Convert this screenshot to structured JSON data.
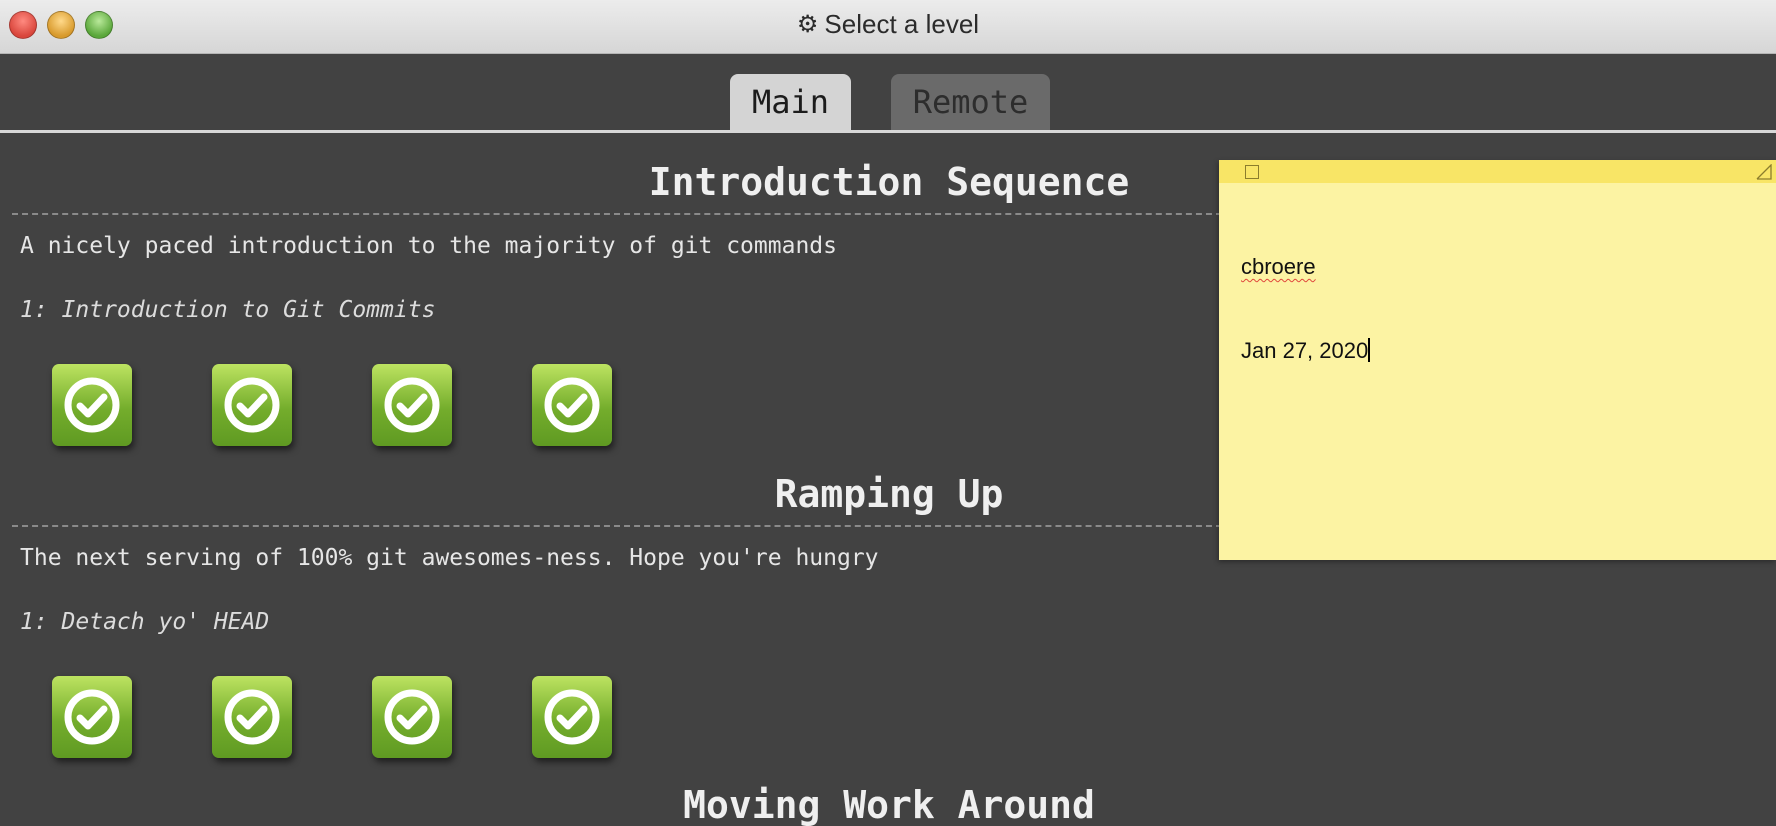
{
  "window": {
    "title": "Select a level",
    "title_icon": "gear-icon"
  },
  "tabs": [
    {
      "label": "Main",
      "active": true
    },
    {
      "label": "Remote",
      "active": false
    }
  ],
  "sections": [
    {
      "title": "Introduction Sequence",
      "description": "A nicely paced introduction to the majority of git commands",
      "level_name": "1: Introduction to Git Commits",
      "levels": [
        {
          "status": "completed",
          "icon": "check-circle-icon"
        },
        {
          "status": "completed",
          "icon": "check-circle-icon"
        },
        {
          "status": "completed",
          "icon": "check-circle-icon"
        },
        {
          "status": "completed",
          "icon": "check-circle-icon"
        }
      ]
    },
    {
      "title": "Ramping Up",
      "description": "The next serving of 100% git awesomes-ness. Hope you're hungry",
      "level_name": "1: Detach yo' HEAD",
      "levels": [
        {
          "status": "completed",
          "icon": "check-circle-icon"
        },
        {
          "status": "completed",
          "icon": "check-circle-icon"
        },
        {
          "status": "completed",
          "icon": "check-circle-icon"
        },
        {
          "status": "completed",
          "icon": "check-circle-icon"
        }
      ]
    },
    {
      "title": "Moving Work Around"
    }
  ],
  "sticky_note": {
    "line1": "cbroere",
    "line2": "Jan 27, 2020"
  },
  "colors": {
    "background": "#424242",
    "level_complete": "#74ad2c",
    "note": "#fcf3a3",
    "note_bar": "#f8e566"
  }
}
